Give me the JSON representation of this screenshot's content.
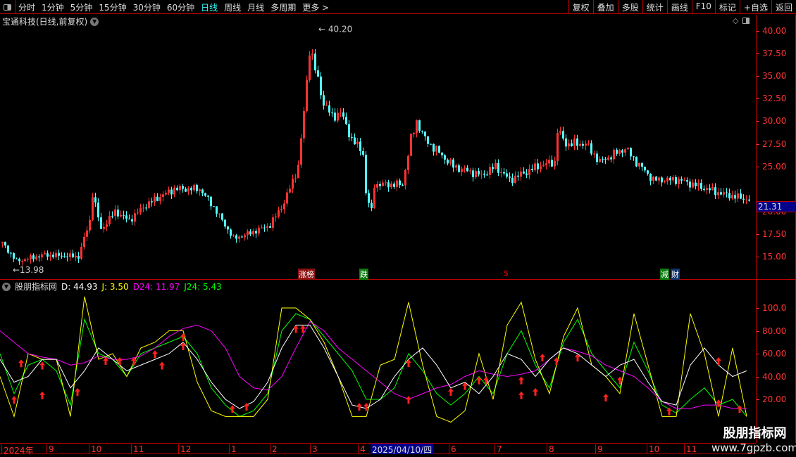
{
  "toolbar": {
    "periods": [
      "分时",
      "1分钟",
      "5分钟",
      "15分钟",
      "30分钟",
      "60分钟",
      "日线",
      "周线",
      "月线",
      "多周期",
      "更多 >"
    ],
    "active": "日线",
    "right_buttons": [
      "复权",
      "叠加",
      "多股",
      "统计",
      "画线",
      "F10",
      "标记",
      "+自选",
      "返回"
    ]
  },
  "stock_title": "宝通科技(日线,前复权)",
  "price_axis": [
    "40.00",
    "37.50",
    "35.00",
    "32.50",
    "30.00",
    "27.50",
    "25.00",
    "20.00",
    "17.50",
    "15.00"
  ],
  "current_price": "21.31",
  "high_label": "40.20",
  "low_label": "13.98",
  "event_tags": [
    {
      "text": "涨榜",
      "color": "#8b1010"
    },
    {
      "text": "跌",
      "color": "#107a10"
    },
    {
      "text": "$",
      "color": "#000"
    },
    {
      "text": "减",
      "color": "#107a10"
    },
    {
      "text": "财",
      "color": "#12336b"
    }
  ],
  "indicator": {
    "name": "股朋指标网",
    "D": "D: 44.93",
    "J": "J: 3.50",
    "D24": "D24: 11.97",
    "J24": "J24: 5.43"
  },
  "indicator_axis": [
    "100.0",
    "80.00",
    "60.00",
    "40.00",
    "20.00"
  ],
  "date_axis": [
    "2024年",
    "9",
    "10",
    "11",
    "12",
    "1",
    "2",
    "3",
    "4",
    "6",
    "7",
    "8",
    "9",
    "10",
    "11"
  ],
  "selected_date": "2025/04/10/四",
  "watermark": {
    "name": "股朋指标网",
    "url": "www.7gpzb.com"
  },
  "chart_data": [
    {
      "type": "candlestick",
      "title": "宝通科技 日线",
      "ylim": [
        13,
        41
      ],
      "price_path": [
        [
          0,
          16.5
        ],
        [
          5,
          14.5
        ],
        [
          15,
          15.2
        ],
        [
          27,
          15
        ],
        [
          31,
          19
        ],
        [
          32,
          22
        ],
        [
          35,
          18
        ],
        [
          40,
          20
        ],
        [
          45,
          19
        ],
        [
          50,
          20.5
        ],
        [
          55,
          21.5
        ],
        [
          61,
          22.5
        ],
        [
          70,
          22.5
        ],
        [
          75,
          20.5
        ],
        [
          82,
          17
        ],
        [
          87,
          17.5
        ],
        [
          95,
          18.5
        ],
        [
          100,
          21
        ],
        [
          105,
          25
        ],
        [
          107,
          31
        ],
        [
          109,
          38
        ],
        [
          110,
          37
        ],
        [
          114,
          32
        ],
        [
          117,
          30.5
        ],
        [
          120,
          31
        ],
        [
          124,
          28
        ],
        [
          128,
          26.5
        ],
        [
          129,
          22
        ],
        [
          131,
          20
        ],
        [
          132,
          23
        ],
        [
          142,
          23
        ],
        [
          145,
          28
        ],
        [
          147,
          30
        ],
        [
          150,
          28
        ],
        [
          160,
          25
        ],
        [
          170,
          24
        ],
        [
          175,
          25
        ],
        [
          180,
          23.5
        ],
        [
          190,
          25
        ],
        [
          196,
          25.5
        ],
        [
          197,
          29
        ],
        [
          200,
          27.5
        ],
        [
          207,
          27.5
        ],
        [
          212,
          25.5
        ],
        [
          221,
          27
        ],
        [
          225,
          25.5
        ],
        [
          231,
          23.5
        ],
        [
          240,
          23.5
        ],
        [
          250,
          22.5
        ],
        [
          255,
          22
        ],
        [
          265,
          21.3
        ]
      ]
    },
    {
      "type": "line",
      "title": "股朋指标网",
      "ylim": [
        0,
        120
      ],
      "series": [
        {
          "name": "D",
          "color": "#ffffff",
          "values": [
            55,
            35,
            40,
            55,
            55,
            30,
            45,
            65,
            55,
            45,
            50,
            55,
            60,
            70,
            55,
            35,
            20,
            12,
            18,
            35,
            65,
            85,
            85,
            65,
            40,
            15,
            12,
            20,
            40,
            55,
            65,
            50,
            30,
            35,
            25,
            40,
            60,
            55,
            40,
            55,
            65,
            60,
            50,
            40,
            50,
            55,
            35,
            18,
            15,
            50,
            65,
            50,
            40,
            45
          ]
        },
        {
          "name": "D24",
          "color": "#ff00ff",
          "values": [
            80,
            70,
            60,
            57,
            55,
            50,
            52,
            58,
            55,
            55,
            58,
            65,
            75,
            82,
            85,
            80,
            65,
            40,
            30,
            28,
            40,
            65,
            88,
            80,
            65,
            55,
            45,
            35,
            25,
            20,
            25,
            30,
            33,
            40,
            45,
            42,
            40,
            42,
            45,
            55,
            65,
            62,
            58,
            50,
            45,
            40,
            30,
            18,
            12,
            12,
            15,
            15,
            12,
            12
          ]
        },
        {
          "name": "J",
          "color": "#ffff00",
          "values": [
            40,
            5,
            60,
            55,
            55,
            5,
            110,
            55,
            60,
            40,
            65,
            70,
            80,
            80,
            35,
            10,
            5,
            5,
            5,
            20,
            100,
            100,
            90,
            70,
            40,
            5,
            5,
            50,
            55,
            105,
            50,
            5,
            0,
            10,
            60,
            20,
            85,
            105,
            55,
            25,
            75,
            100,
            50,
            40,
            25,
            95,
            50,
            5,
            5,
            95,
            60,
            5,
            65,
            5
          ]
        },
        {
          "name": "J24",
          "color": "#00ff00",
          "values": [
            60,
            25,
            50,
            55,
            45,
            15,
            90,
            60,
            55,
            40,
            60,
            65,
            70,
            75,
            60,
            30,
            15,
            5,
            10,
            25,
            80,
            95,
            90,
            75,
            60,
            45,
            20,
            20,
            30,
            60,
            45,
            25,
            15,
            25,
            40,
            25,
            60,
            80,
            50,
            30,
            70,
            90,
            60,
            45,
            30,
            70,
            45,
            15,
            8,
            20,
            30,
            15,
            20,
            5
          ]
        }
      ],
      "buy_signals": [
        [
          1,
          18
        ],
        [
          1.5,
          50
        ],
        [
          3,
          48
        ],
        [
          3,
          22
        ],
        [
          5.5,
          25
        ],
        [
          7.5,
          52
        ],
        [
          8.5,
          52
        ],
        [
          9.5,
          52
        ],
        [
          11,
          58
        ],
        [
          11.5,
          48
        ],
        [
          13,
          73
        ],
        [
          13,
          65
        ],
        [
          16.5,
          10
        ],
        [
          17.5,
          12
        ],
        [
          21,
          80
        ],
        [
          21.5,
          80
        ],
        [
          25.5,
          12
        ],
        [
          26,
          12
        ],
        [
          29,
          18
        ],
        [
          29,
          50
        ],
        [
          32,
          25
        ],
        [
          33,
          30
        ],
        [
          34,
          35
        ],
        [
          34.5,
          35
        ],
        [
          37,
          22
        ],
        [
          37,
          35
        ],
        [
          38,
          25
        ],
        [
          38.5,
          55
        ],
        [
          39.5,
          52
        ],
        [
          41,
          55
        ],
        [
          43,
          20
        ],
        [
          44,
          35
        ],
        [
          47.5,
          8
        ],
        [
          51,
          15
        ],
        [
          51,
          52
        ],
        [
          52.5,
          10
        ]
      ]
    }
  ]
}
